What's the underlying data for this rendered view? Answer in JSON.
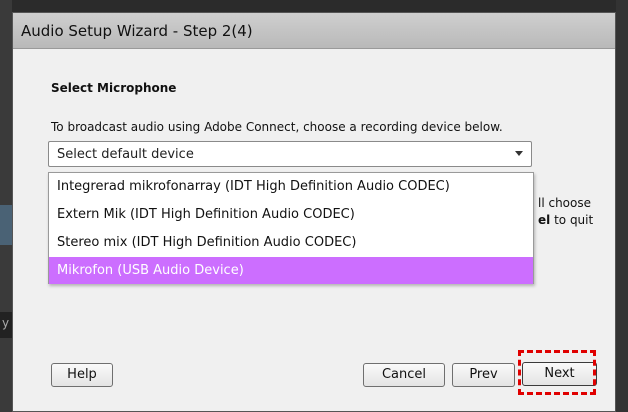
{
  "window": {
    "title": "Audio Setup Wizard - Step 2(4)"
  },
  "section": {
    "heading": "Select Microphone",
    "intro": "To broadcast audio using Adobe Connect, choose a recording device below."
  },
  "device_select": {
    "selected": "Select default device",
    "options": [
      "Integrerad mikrofonarray (IDT High Definition Audio CODEC)",
      "Extern Mik (IDT High Definition Audio CODEC)",
      "Stereo mix (IDT High Definition Audio CODEC)",
      "Mikrofon (USB Audio Device)"
    ],
    "highlighted_index": 3
  },
  "obscured_text": {
    "line1": "ll choose",
    "line2_bold": "el",
    "line2_rest": " to quit"
  },
  "buttons": {
    "help": "Help",
    "cancel": "Cancel",
    "prev": "Prev",
    "next": "Next"
  },
  "background": {
    "left_strip_text": "y"
  },
  "colors": {
    "highlight_option": "#cc6eff",
    "annotation_box": "#e00000"
  }
}
